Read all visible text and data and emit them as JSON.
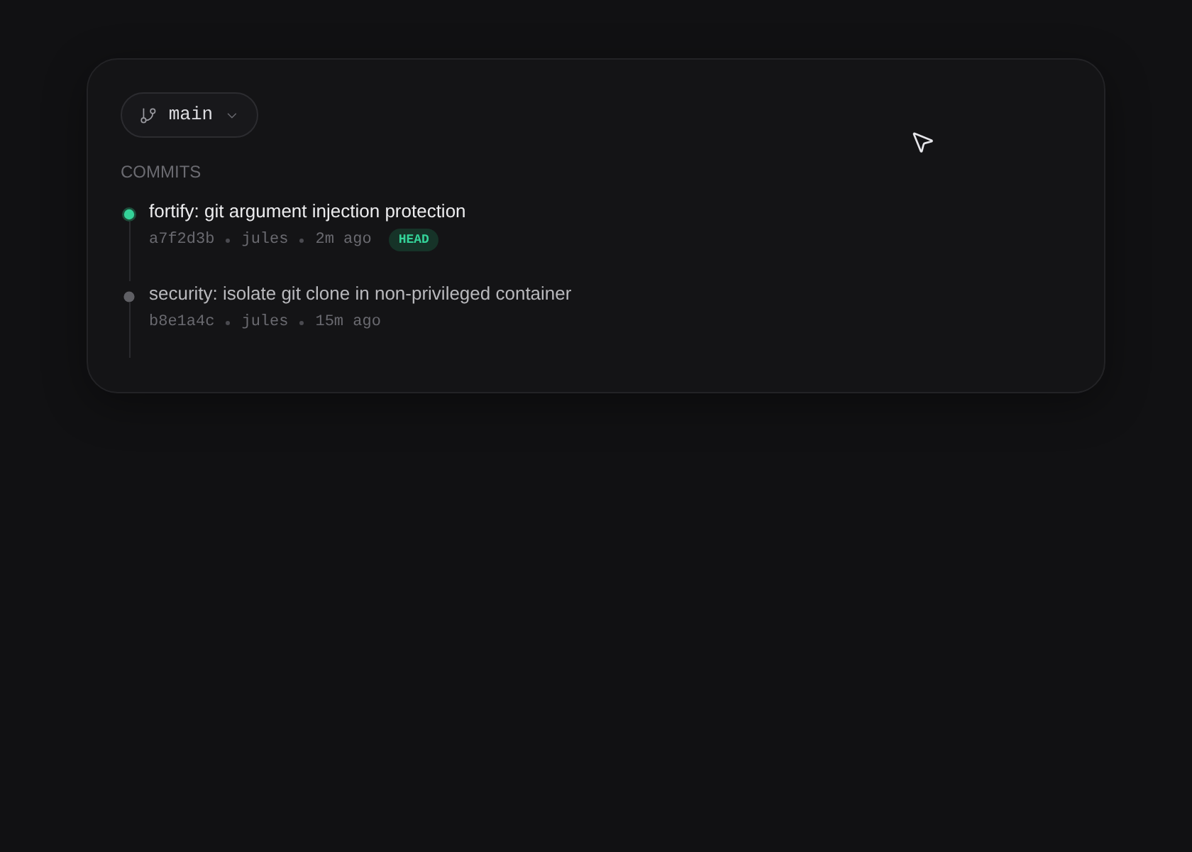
{
  "branch": {
    "name": "main"
  },
  "section_label": "COMMITS",
  "commits": [
    {
      "message": "fortify: git argument injection protection",
      "hash": "a7f2d3b",
      "author": "jules",
      "time": "2m ago",
      "badge": "HEAD",
      "selected": true
    },
    {
      "message": "security: isolate git clone in non-privileged container",
      "hash": "b8e1a4c",
      "author": "jules",
      "time": "15m ago",
      "selected": false
    }
  ]
}
